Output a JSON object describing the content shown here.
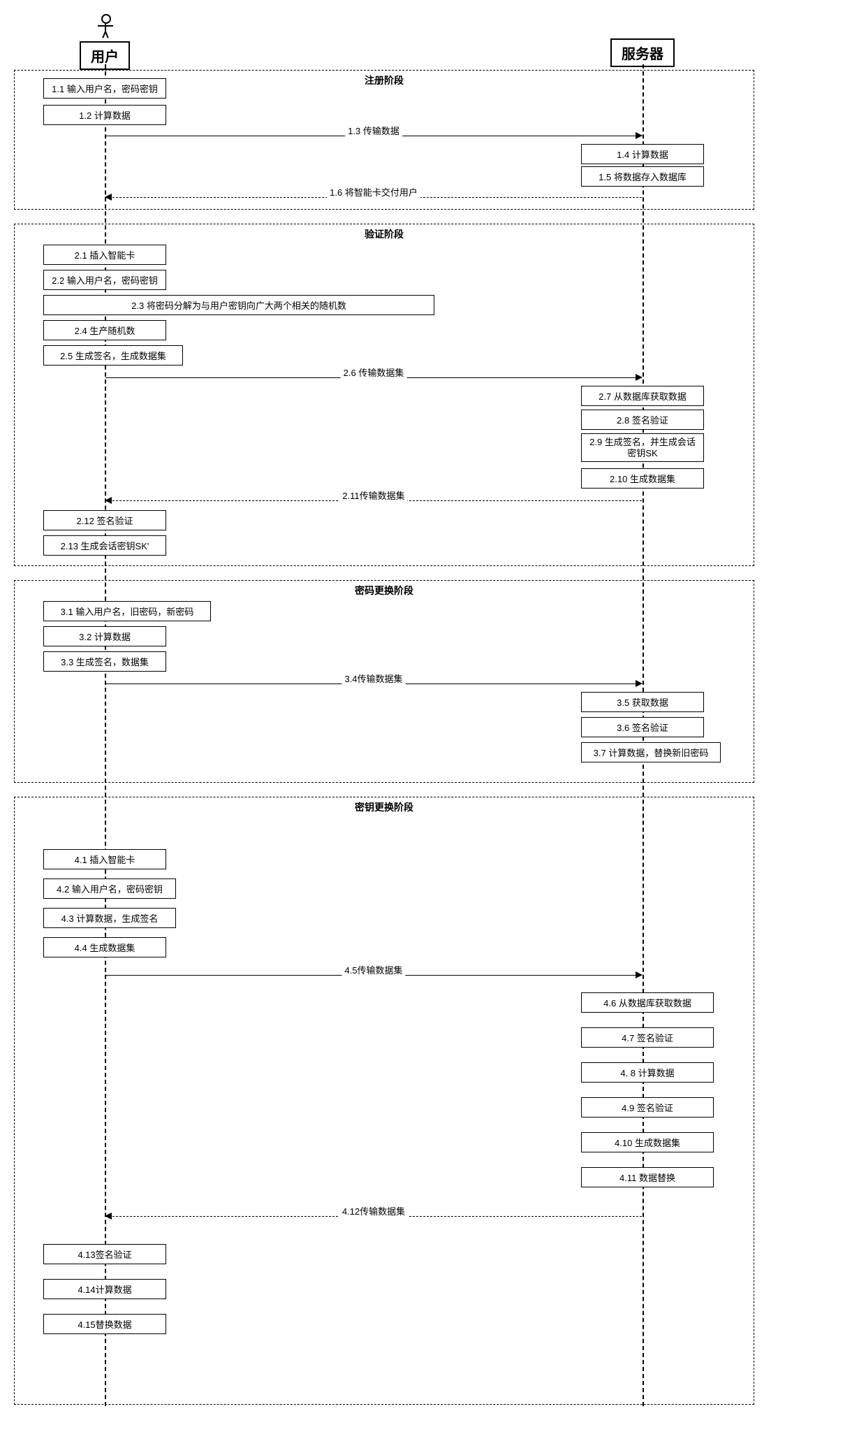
{
  "actors": {
    "user": "用户",
    "server": "服务器"
  },
  "phases": {
    "p1": "注册阶段",
    "p2": "验证阶段",
    "p3": "密码更换阶段",
    "p4": "密钥更换阶段"
  },
  "steps": {
    "s1_1": "1.1 输入用户名，密码密钥",
    "s1_2": "1.2 计算数据",
    "s1_4": "1.4 计算数据",
    "s1_5": "1.5 将数据存入数据库",
    "s2_1": "2.1 插入智能卡",
    "s2_2": "2.2 输入用户名，密码密钥",
    "s2_3": "2.3 将密码分解为与用户密钥向广大两个相关的随机数",
    "s2_4": "2.4 生产随机数",
    "s2_5": "2.5 生成签名，生成数据集",
    "s2_7": "2.7 从数据库获取数据",
    "s2_8": "2.8 签名验证",
    "s2_9": "2.9 生成签名，并生成会话密钥SK",
    "s2_10": "2.10 生成数据集",
    "s2_12": "2.12 签名验证",
    "s2_13": "2.13 生成会话密钥SK'",
    "s3_1": "3.1 输入用户名，旧密码，新密码",
    "s3_2": "3.2 计算数据",
    "s3_3": "3.3 生成签名，数据集",
    "s3_5": "3.5 获取数据",
    "s3_6": "3.6 签名验证",
    "s3_7": "3.7 计算数据，替换新旧密码",
    "s4_1": "4.1 插入智能卡",
    "s4_2": "4.2 输入用户名，密码密钥",
    "s4_3": "4.3 计算数据，生成签名",
    "s4_4": "4.4 生成数据集",
    "s4_6": "4.6 从数据库获取数据",
    "s4_7": "4.7 签名验证",
    "s4_8": "4. 8 计算数据",
    "s4_9": "4.9 签名验证",
    "s4_10": "4.10 生成数据集",
    "s4_11": "4.11 数据替换",
    "s4_13": "4.13签名验证",
    "s4_14": "4.14计算数据",
    "s4_15": "4.15替换数据"
  },
  "messages": {
    "m1_3": "1.3 传输数据",
    "m1_6": "1.6 将智能卡交付用户",
    "m2_6": "2.6 传输数据集",
    "m2_11": "2.11传输数据集",
    "m3_4": "3.4传输数据集",
    "m4_5": "4.5传输数据集",
    "m4_12": "4.12传输数据集"
  }
}
